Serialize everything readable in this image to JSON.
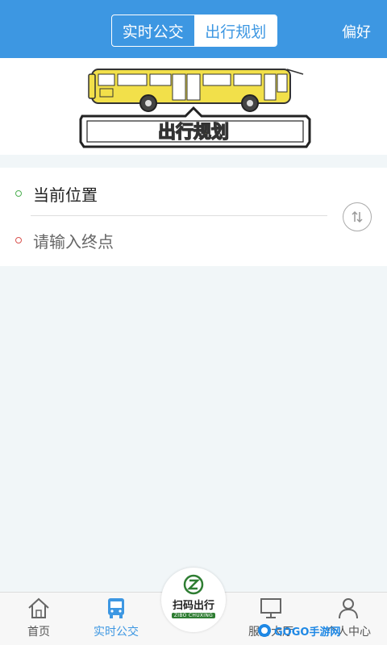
{
  "header": {
    "tabs": [
      {
        "label": "实时公交",
        "active": false
      },
      {
        "label": "出行规划",
        "active": true
      }
    ],
    "preference_label": "偏好"
  },
  "banner": {
    "title_text": "出行规划"
  },
  "route_input": {
    "origin": "当前位置",
    "destination_placeholder": "请输入终点"
  },
  "bottom_nav": {
    "items": [
      {
        "label": "首页",
        "icon": "home-icon",
        "active": false
      },
      {
        "label": "实时公交",
        "icon": "bus-icon",
        "active": true
      },
      {
        "label": "服务大厅",
        "icon": "monitor-icon",
        "active": false
      },
      {
        "label": "个人中心",
        "icon": "person-icon",
        "active": false
      }
    ],
    "center": {
      "label": "扫码出行",
      "sub_label": "ZIBO CHUXING"
    }
  },
  "watermark": {
    "text": "GOGO手游网"
  },
  "colors": {
    "primary": "#3d97e2",
    "background": "#f1f6f8",
    "bus_yellow": "#f2e04a",
    "brand_green": "#2e7d32"
  }
}
